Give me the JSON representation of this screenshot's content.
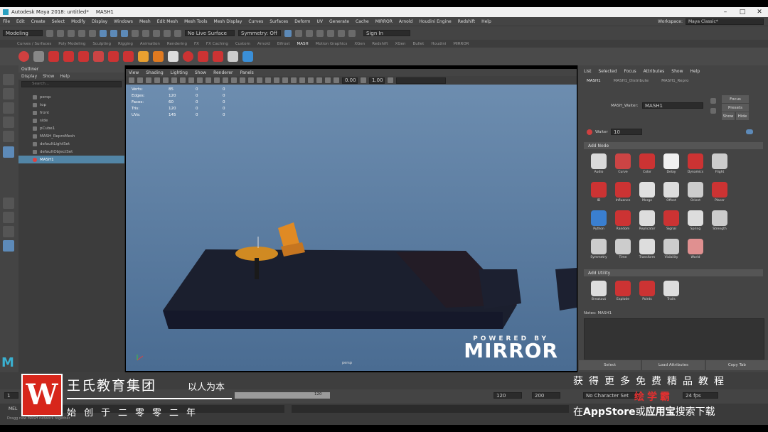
{
  "window": {
    "title": "Autodesk Maya 2018: untitled*",
    "subtitle": "MASH1",
    "controls": [
      "–",
      "□",
      "✕"
    ]
  },
  "menubar": {
    "items": [
      "File",
      "Edit",
      "Create",
      "Select",
      "Modify",
      "Display",
      "Windows",
      "Mesh",
      "Edit Mesh",
      "Mesh Tools",
      "Mesh Display",
      "Curves",
      "Surfaces",
      "Deform",
      "UV",
      "Generate",
      "Cache",
      "MIRROR",
      "Arnold",
      "Houdini Engine",
      "Redshift",
      "Help"
    ],
    "workspace_label": "Workspace:",
    "workspace_value": "Maya Classic*"
  },
  "statusline": {
    "mode": "Modeling",
    "live_surface": "No Live Surface",
    "symmetry": "Symmetry: Off",
    "sign_in": "Sign In"
  },
  "shelf": {
    "tabs": [
      "Curves / Surfaces",
      "Poly Modeling",
      "Sculpting",
      "Rigging",
      "Animation",
      "Rendering",
      "FX",
      "FX Caching",
      "Custom",
      "Arnold",
      "Bifrost",
      "MASH",
      "Motion Graphics",
      "XGen",
      "Redshift",
      "XGen",
      "Bullet",
      "Houdini",
      "MIRROR"
    ],
    "active_tab": "MASH",
    "icon_colors": [
      "#d04040",
      "#888888",
      "#cc3333",
      "#cc3333",
      "#cc3333",
      "#cc4444",
      "#cc3333",
      "#cc3333",
      "#e8a030",
      "#e07a20",
      "#dddddd",
      "#cc3333",
      "#cc3333",
      "#cc3333",
      "#cccccc",
      "#3a8fd8"
    ]
  },
  "outliner": {
    "title": "Outliner",
    "menu": [
      "Display",
      "Show",
      "Help"
    ],
    "search_placeholder": "Search...",
    "items": [
      {
        "label": "persp",
        "selected": false
      },
      {
        "label": "top",
        "selected": false
      },
      {
        "label": "front",
        "selected": false
      },
      {
        "label": "side",
        "selected": false
      },
      {
        "label": "pCube1",
        "selected": false
      },
      {
        "label": "MASH_ReproMesh",
        "selected": false
      },
      {
        "label": "defaultLightSet",
        "selected": false
      },
      {
        "label": "defaultObjectSet",
        "selected": false
      },
      {
        "label": "MASH1",
        "selected": true
      }
    ]
  },
  "viewport": {
    "menu": [
      "View",
      "Shading",
      "Lighting",
      "Show",
      "Renderer",
      "Panels"
    ],
    "toolbar_fields": [
      "0.00",
      "1.00"
    ],
    "hud": [
      {
        "label": "Verts:",
        "values": [
          "85",
          "0",
          "0"
        ]
      },
      {
        "label": "Edges:",
        "values": [
          "120",
          "0",
          "0"
        ]
      },
      {
        "label": "Faces:",
        "values": [
          "60",
          "0",
          "0"
        ]
      },
      {
        "label": "Tris:",
        "values": [
          "120",
          "0",
          "0"
        ]
      },
      {
        "label": "UVs:",
        "values": [
          "145",
          "0",
          "0"
        ]
      }
    ],
    "camera": "persp",
    "watermark_top": "POWERED BY",
    "watermark_main": "MIRROR"
  },
  "attribute_editor": {
    "menu": [
      "List",
      "Selected",
      "Focus",
      "Attributes",
      "Show",
      "Help"
    ],
    "tabs": [
      "MASH1",
      "MASH1_Distribute",
      "MASH1_Repro"
    ],
    "active_tab": "MASH1",
    "node_label": "MASH_Waiter:",
    "node_value": "MASH1",
    "buttons": [
      "Focus",
      "Presets",
      "Show",
      "Hide"
    ],
    "waiter_label": "Waiter",
    "waiter_value": "10",
    "add_node_title": "Add Node",
    "nodes": [
      {
        "label": "Audio",
        "color": "#d9d9d9"
      },
      {
        "label": "Curve",
        "color": "#cc4444"
      },
      {
        "label": "Color",
        "color": "#cc3333"
      },
      {
        "label": "Delay",
        "color": "#f0f0f0"
      },
      {
        "label": "Dynamics",
        "color": "#cc3333"
      },
      {
        "label": "Flight",
        "color": "#cccccc"
      },
      {
        "label": "ID",
        "color": "#cc3333"
      },
      {
        "label": "Influence",
        "color": "#cc3333"
      },
      {
        "label": "Merge",
        "color": "#e0e0e0"
      },
      {
        "label": "Offset",
        "color": "#dddddd"
      },
      {
        "label": "Orient",
        "color": "#cccccc"
      },
      {
        "label": "Placer",
        "color": "#cc3333"
      },
      {
        "label": "Python",
        "color": "#3a7fd0"
      },
      {
        "label": "Random",
        "color": "#cc3333"
      },
      {
        "label": "Replicator",
        "color": "#dddddd"
      },
      {
        "label": "Signal",
        "color": "#cc3333"
      },
      {
        "label": "Spring",
        "color": "#dddddd"
      },
      {
        "label": "Strength",
        "color": "#cccccc"
      },
      {
        "label": "Symmetry",
        "color": "#cccccc"
      },
      {
        "label": "Time",
        "color": "#cccccc"
      },
      {
        "label": "Transform",
        "color": "#dddddd"
      },
      {
        "label": "Visibility",
        "color": "#cccccc"
      },
      {
        "label": "World",
        "color": "#e09090"
      }
    ],
    "add_utility_title": "Add Utility",
    "utilities": [
      {
        "label": "Breakout",
        "color": "#dddddd"
      },
      {
        "label": "Explode",
        "color": "#cc3333"
      },
      {
        "label": "Points",
        "color": "#cc3333"
      },
      {
        "label": "Trails",
        "color": "#dddddd"
      }
    ],
    "notes_label": "Notes: MASH1",
    "bottom_buttons": [
      "Select",
      "Load Attributes",
      "Copy Tab"
    ]
  },
  "timeline": {
    "start": "1",
    "end": "120",
    "range_end_1": "120",
    "range_end_2": "200",
    "char_set": "No Character Set",
    "fps": "24 fps",
    "mel_label": "MEL",
    "status_text": "Dragg new MASH network together"
  },
  "overlay_left": {
    "logo_letter": "W",
    "line1": "王氏教育集团",
    "line1b": "以人为本",
    "line2": "始创于二零零二年"
  },
  "overlay_right": {
    "line1": "获得更多免费精品教程",
    "line2": "绘学霸",
    "line3a": "在",
    "line3b": "AppStore",
    "line3c": "或",
    "line3d": "应用宝",
    "line3e": "搜索下载"
  }
}
